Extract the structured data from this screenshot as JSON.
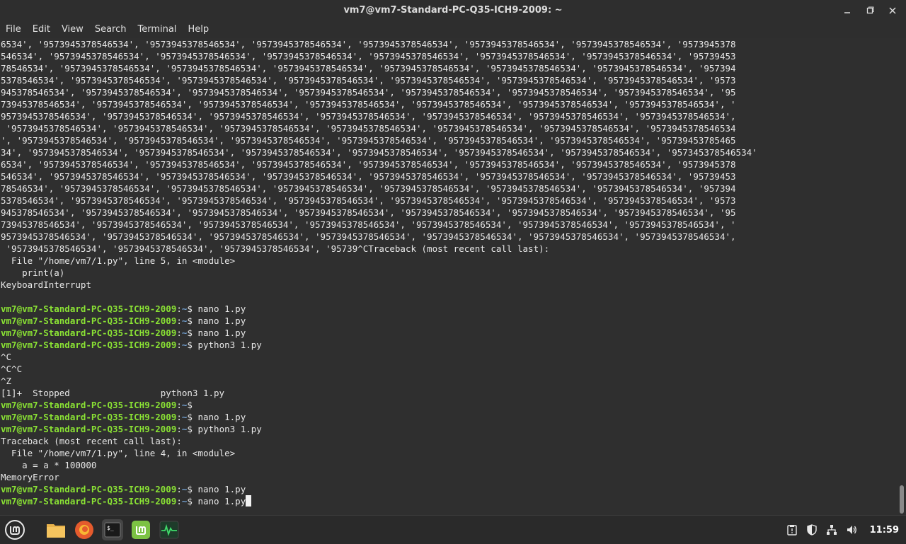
{
  "window": {
    "title": "vm7@vm7-Standard-PC-Q35-ICH9-2009: ~"
  },
  "menu": [
    "File",
    "Edit",
    "View",
    "Search",
    "Terminal",
    "Help"
  ],
  "terminal": {
    "prompt_user": "vm7@vm7-Standard-PC-Q35-ICH9-2009",
    "prompt_sep": ":",
    "prompt_cwd": "~",
    "prompt_end": "$ ",
    "lines": [
      {
        "t": "out",
        "text": "6534', '9573945378546534', '9573945378546534', '9573945378546534', '9573945378546534', '9573945378546534', '9573945378546534', '9573945378"
      },
      {
        "t": "out",
        "text": "546534', '9573945378546534', '9573945378546534', '9573945378546534', '9573945378546534', '9573945378546534', '9573945378546534', '95739453"
      },
      {
        "t": "out",
        "text": "78546534', '9573945378546534', '9573945378546534', '9573945378546534', '9573945378546534', '9573945378546534', '9573945378546534', '957394"
      },
      {
        "t": "out",
        "text": "5378546534', '9573945378546534', '9573945378546534', '9573945378546534', '9573945378546534', '9573945378546534', '9573945378546534', '9573"
      },
      {
        "t": "out",
        "text": "945378546534', '9573945378546534', '9573945378546534', '9573945378546534', '9573945378546534', '9573945378546534', '9573945378546534', '95"
      },
      {
        "t": "out",
        "text": "73945378546534', '9573945378546534', '9573945378546534', '9573945378546534', '9573945378546534', '9573945378546534', '9573945378546534', '"
      },
      {
        "t": "out",
        "text": "9573945378546534', '9573945378546534', '9573945378546534', '9573945378546534', '9573945378546534', '9573945378546534', '9573945378546534',"
      },
      {
        "t": "out",
        "text": " '9573945378546534', '9573945378546534', '9573945378546534', '9573945378546534', '9573945378546534', '9573945378546534', '9573945378546534"
      },
      {
        "t": "out",
        "text": "', '9573945378546534', '9573945378546534', '9573945378546534', '9573945378546534', '9573945378546534', '9573945378546534', '95739453785465"
      },
      {
        "t": "out",
        "text": "34', '9573945378546534', '9573945378546534', '9573945378546534', '9573945378546534', '9573945378546534', '9573945378546534', '957345378546534'"
      },
      {
        "t": "out",
        "text": "6534', '9573945378546534', '9573945378546534', '9573945378546534', '9573945378546534', '9573945378546534', '9573945378546534', '9573945378"
      },
      {
        "t": "out",
        "text": "546534', '9573945378546534', '9573945378546534', '9573945378546534', '9573945378546534', '9573945378546534', '9573945378546534', '95739453"
      },
      {
        "t": "out",
        "text": "78546534', '9573945378546534', '9573945378546534', '9573945378546534', '9573945378546534', '9573945378546534', '9573945378546534', '957394"
      },
      {
        "t": "out",
        "text": "5378546534', '9573945378546534', '9573945378546534', '9573945378546534', '9573945378546534', '9573945378546534', '9573945378546534', '9573"
      },
      {
        "t": "out",
        "text": "945378546534', '9573945378546534', '9573945378546534', '9573945378546534', '9573945378546534', '9573945378546534', '9573945378546534', '95"
      },
      {
        "t": "out",
        "text": "73945378546534', '9573945378546534', '9573945378546534', '9573945378546534', '9573945378546534', '9573945378546534', '9573945378546534', '"
      },
      {
        "t": "out",
        "text": "9573945378546534', '9573945378546534', '9573945378546534', '9573945378546534', '9573945378546534', '9573945378546534', '9573945378546534',"
      },
      {
        "t": "out",
        "text": " '9573945378546534', '9573945378546534', '9573945378546534', '95739^CTraceback (most recent call last):"
      },
      {
        "t": "out",
        "text": "  File \"/home/vm7/1.py\", line 5, in <module>"
      },
      {
        "t": "out",
        "text": "    print(a)"
      },
      {
        "t": "out",
        "text": "KeyboardInterrupt"
      },
      {
        "t": "out",
        "text": ""
      },
      {
        "t": "cmd",
        "text": "nano 1.py"
      },
      {
        "t": "cmd",
        "text": "nano 1.py"
      },
      {
        "t": "cmd",
        "text": "nano 1.py"
      },
      {
        "t": "cmd",
        "text": "python3 1.py"
      },
      {
        "t": "out",
        "text": "^C"
      },
      {
        "t": "out",
        "text": "^C^C"
      },
      {
        "t": "out",
        "text": "^Z"
      },
      {
        "t": "out",
        "text": "[1]+  Stopped                 python3 1.py"
      },
      {
        "t": "cmd",
        "text": ""
      },
      {
        "t": "cmd",
        "text": "nano 1.py"
      },
      {
        "t": "cmd",
        "text": "python3 1.py"
      },
      {
        "t": "out",
        "text": "Traceback (most recent call last):"
      },
      {
        "t": "out",
        "text": "  File \"/home/vm7/1.py\", line 4, in <module>"
      },
      {
        "t": "out",
        "text": "    a = a * 100000"
      },
      {
        "t": "out",
        "text": "MemoryError"
      },
      {
        "t": "cmd",
        "text": "nano 1.py"
      },
      {
        "t": "cmd_cursor",
        "text": "nano 1.py"
      }
    ]
  },
  "taskbar": {
    "apps": [
      {
        "name": "mint-menu-icon",
        "label": "Menu"
      },
      {
        "name": "files-icon",
        "label": "Files"
      },
      {
        "name": "firefox-icon",
        "label": "Firefox"
      },
      {
        "name": "terminal-icon",
        "label": "Terminal"
      },
      {
        "name": "mintinstall-icon",
        "label": "Software Manager"
      },
      {
        "name": "system-monitor-icon",
        "label": "System Monitor"
      }
    ],
    "tray": [
      "clipboard-icon",
      "shield-icon",
      "network-icon",
      "volume-icon"
    ],
    "clock": "11:59"
  },
  "colors": {
    "prompt_user": "#8ae234",
    "prompt_cwd": "#729fcf",
    "terminal_bg": "#2f2f2f",
    "text": "#e8e8e8"
  }
}
